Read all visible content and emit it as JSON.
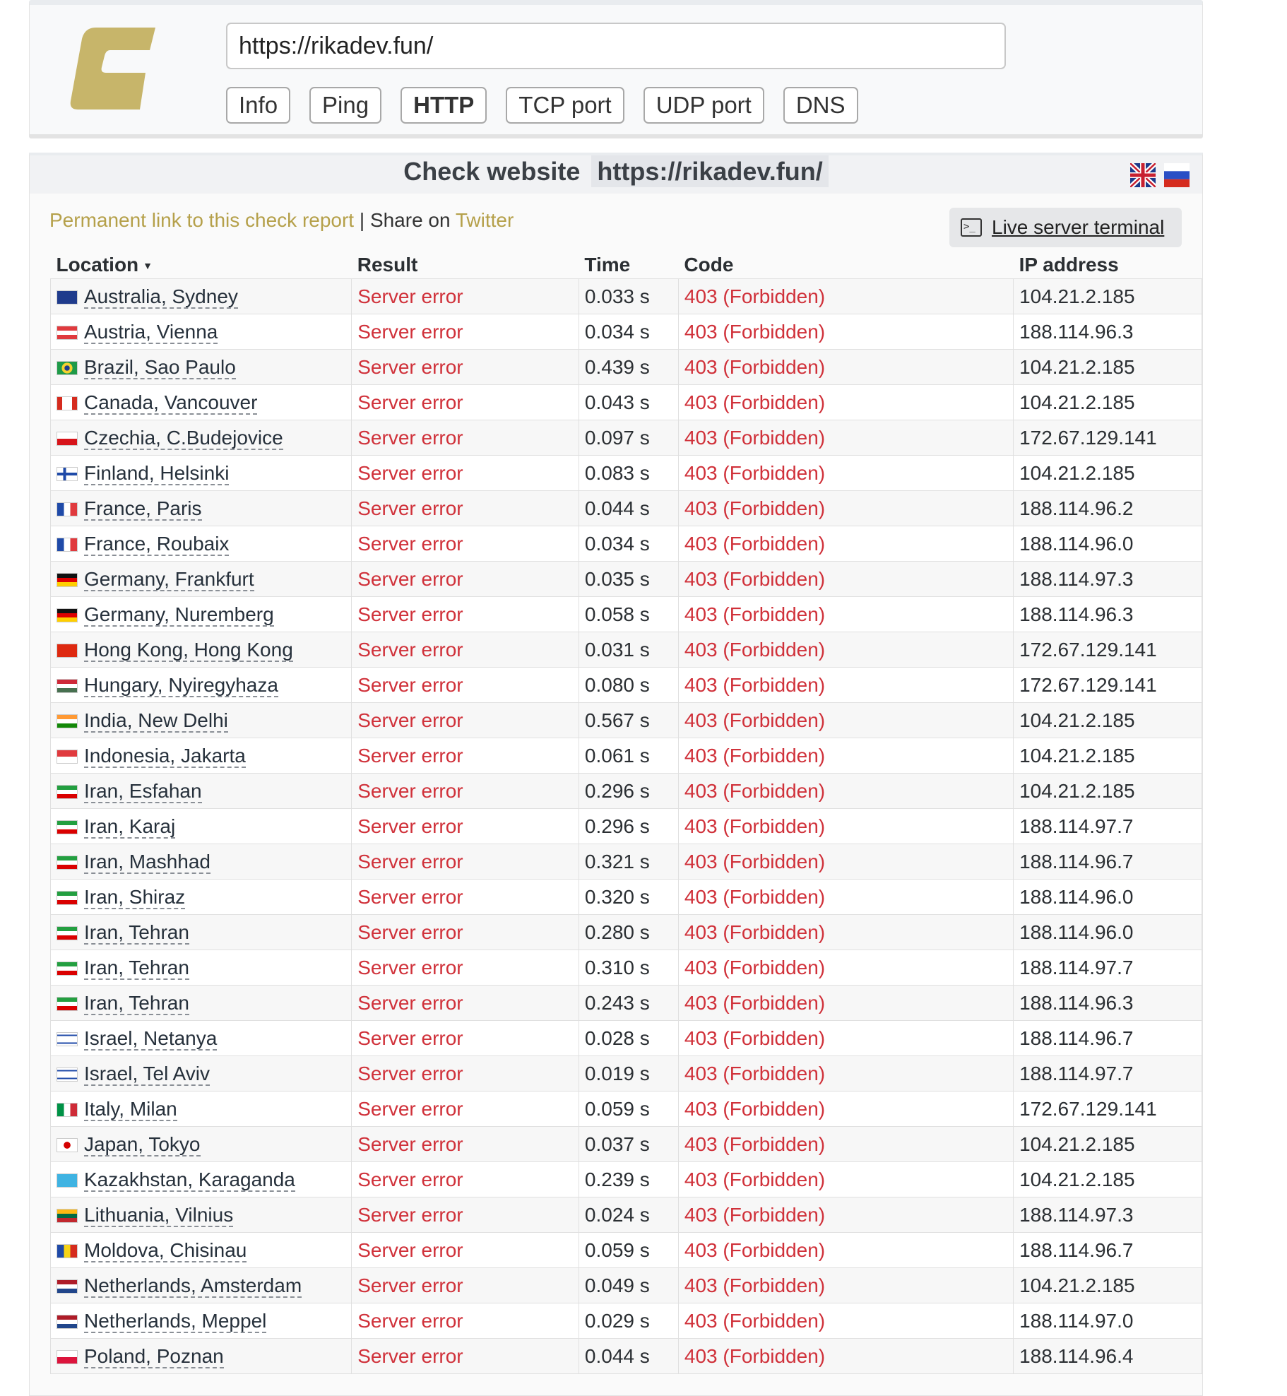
{
  "colors": {
    "accent_gold": "#c7b56a",
    "error_red": "#d0313a",
    "link_gold": "#b5a04a"
  },
  "header": {
    "url_value": "https://rikadev.fun/",
    "tabs": [
      {
        "label": "Info",
        "active": false
      },
      {
        "label": "Ping",
        "active": false
      },
      {
        "label": "HTTP",
        "active": true
      },
      {
        "label": "TCP port",
        "active": false
      },
      {
        "label": "UDP port",
        "active": false
      },
      {
        "label": "DNS",
        "active": false
      }
    ]
  },
  "panel": {
    "title_prefix": "Check website",
    "title_url": "https://rikadev.fun/",
    "languages": [
      "en-flag-icon",
      "ru-flag-icon"
    ],
    "permanent_link": "Permanent link to this check report",
    "separator": "|",
    "share_text": "Share on",
    "twitter": "Twitter",
    "terminal_label": "Live server terminal",
    "terminal_icon": "terminal-icon"
  },
  "table": {
    "headers": {
      "location": "Location",
      "result": "Result",
      "time": "Time",
      "code": "Code",
      "ip": "IP address"
    },
    "rows": [
      {
        "flag": "au",
        "location": "Australia, Sydney",
        "result": "Server error",
        "time": "0.033 s",
        "code": "403 (Forbidden)",
        "ip": "104.21.2.185"
      },
      {
        "flag": "at",
        "location": "Austria, Vienna",
        "result": "Server error",
        "time": "0.034 s",
        "code": "403 (Forbidden)",
        "ip": "188.114.96.3"
      },
      {
        "flag": "br",
        "location": "Brazil, Sao Paulo",
        "result": "Server error",
        "time": "0.439 s",
        "code": "403 (Forbidden)",
        "ip": "104.21.2.185"
      },
      {
        "flag": "ca",
        "location": "Canada, Vancouver",
        "result": "Server error",
        "time": "0.043 s",
        "code": "403 (Forbidden)",
        "ip": "104.21.2.185"
      },
      {
        "flag": "cz",
        "location": "Czechia, C.Budejovice",
        "result": "Server error",
        "time": "0.097 s",
        "code": "403 (Forbidden)",
        "ip": "172.67.129.141"
      },
      {
        "flag": "fi",
        "location": "Finland, Helsinki",
        "result": "Server error",
        "time": "0.083 s",
        "code": "403 (Forbidden)",
        "ip": "104.21.2.185"
      },
      {
        "flag": "fr",
        "location": "France, Paris",
        "result": "Server error",
        "time": "0.044 s",
        "code": "403 (Forbidden)",
        "ip": "188.114.96.2"
      },
      {
        "flag": "fr",
        "location": "France, Roubaix",
        "result": "Server error",
        "time": "0.034 s",
        "code": "403 (Forbidden)",
        "ip": "188.114.96.0"
      },
      {
        "flag": "de",
        "location": "Germany, Frankfurt",
        "result": "Server error",
        "time": "0.035 s",
        "code": "403 (Forbidden)",
        "ip": "188.114.97.3"
      },
      {
        "flag": "de",
        "location": "Germany, Nuremberg",
        "result": "Server error",
        "time": "0.058 s",
        "code": "403 (Forbidden)",
        "ip": "188.114.96.3"
      },
      {
        "flag": "hk",
        "location": "Hong Kong, Hong Kong",
        "result": "Server error",
        "time": "0.031 s",
        "code": "403 (Forbidden)",
        "ip": "172.67.129.141"
      },
      {
        "flag": "hu",
        "location": "Hungary, Nyiregyhaza",
        "result": "Server error",
        "time": "0.080 s",
        "code": "403 (Forbidden)",
        "ip": "172.67.129.141"
      },
      {
        "flag": "in",
        "location": "India, New Delhi",
        "result": "Server error",
        "time": "0.567 s",
        "code": "403 (Forbidden)",
        "ip": "104.21.2.185"
      },
      {
        "flag": "id",
        "location": "Indonesia, Jakarta",
        "result": "Server error",
        "time": "0.061 s",
        "code": "403 (Forbidden)",
        "ip": "104.21.2.185"
      },
      {
        "flag": "ir",
        "location": "Iran, Esfahan",
        "result": "Server error",
        "time": "0.296 s",
        "code": "403 (Forbidden)",
        "ip": "104.21.2.185"
      },
      {
        "flag": "ir",
        "location": "Iran, Karaj",
        "result": "Server error",
        "time": "0.296 s",
        "code": "403 (Forbidden)",
        "ip": "188.114.97.7"
      },
      {
        "flag": "ir",
        "location": "Iran, Mashhad",
        "result": "Server error",
        "time": "0.321 s",
        "code": "403 (Forbidden)",
        "ip": "188.114.96.7"
      },
      {
        "flag": "ir",
        "location": "Iran, Shiraz",
        "result": "Server error",
        "time": "0.320 s",
        "code": "403 (Forbidden)",
        "ip": "188.114.96.0"
      },
      {
        "flag": "ir",
        "location": "Iran, Tehran",
        "result": "Server error",
        "time": "0.280 s",
        "code": "403 (Forbidden)",
        "ip": "188.114.96.0"
      },
      {
        "flag": "ir",
        "location": "Iran, Tehran",
        "result": "Server error",
        "time": "0.310 s",
        "code": "403 (Forbidden)",
        "ip": "188.114.97.7"
      },
      {
        "flag": "ir",
        "location": "Iran, Tehran",
        "result": "Server error",
        "time": "0.243 s",
        "code": "403 (Forbidden)",
        "ip": "188.114.96.3"
      },
      {
        "flag": "il",
        "location": "Israel, Netanya",
        "result": "Server error",
        "time": "0.028 s",
        "code": "403 (Forbidden)",
        "ip": "188.114.96.7"
      },
      {
        "flag": "il",
        "location": "Israel, Tel Aviv",
        "result": "Server error",
        "time": "0.019 s",
        "code": "403 (Forbidden)",
        "ip": "188.114.97.7"
      },
      {
        "flag": "it",
        "location": "Italy, Milan",
        "result": "Server error",
        "time": "0.059 s",
        "code": "403 (Forbidden)",
        "ip": "172.67.129.141"
      },
      {
        "flag": "jp",
        "location": "Japan, Tokyo",
        "result": "Server error",
        "time": "0.037 s",
        "code": "403 (Forbidden)",
        "ip": "104.21.2.185"
      },
      {
        "flag": "kz",
        "location": "Kazakhstan, Karaganda",
        "result": "Server error",
        "time": "0.239 s",
        "code": "403 (Forbidden)",
        "ip": "104.21.2.185"
      },
      {
        "flag": "lt",
        "location": "Lithuania, Vilnius",
        "result": "Server error",
        "time": "0.024 s",
        "code": "403 (Forbidden)",
        "ip": "188.114.97.3"
      },
      {
        "flag": "md",
        "location": "Moldova, Chisinau",
        "result": "Server error",
        "time": "0.059 s",
        "code": "403 (Forbidden)",
        "ip": "188.114.96.7"
      },
      {
        "flag": "nl",
        "location": "Netherlands, Amsterdam",
        "result": "Server error",
        "time": "0.049 s",
        "code": "403 (Forbidden)",
        "ip": "104.21.2.185"
      },
      {
        "flag": "nl",
        "location": "Netherlands, Meppel",
        "result": "Server error",
        "time": "0.029 s",
        "code": "403 (Forbidden)",
        "ip": "188.114.97.0"
      },
      {
        "flag": "pl",
        "location": "Poland, Poznan",
        "result": "Server error",
        "time": "0.044 s",
        "code": "403 (Forbidden)",
        "ip": "188.114.96.4"
      }
    ]
  }
}
